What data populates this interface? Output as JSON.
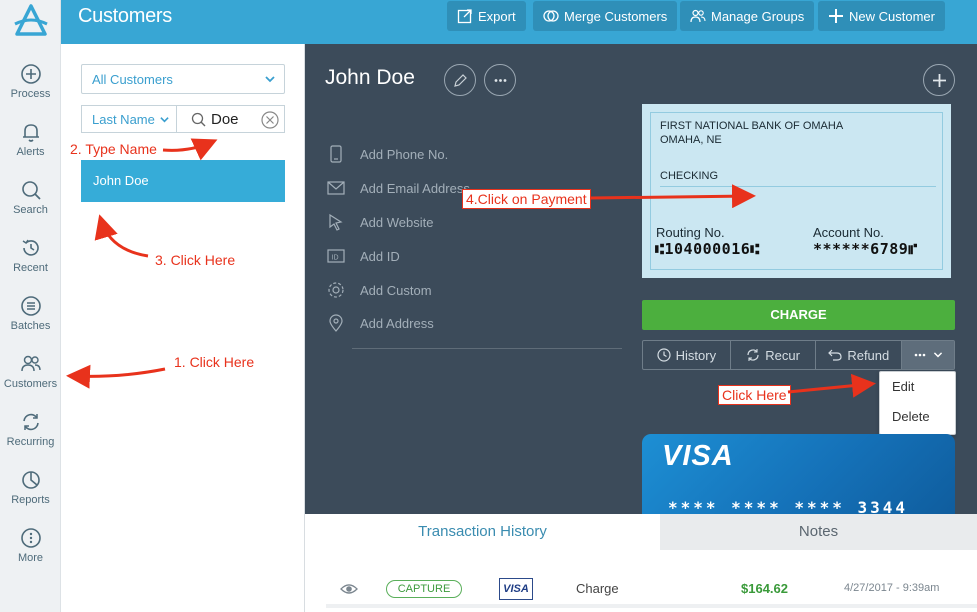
{
  "header": {
    "title": "Customers",
    "buttons": {
      "export": "Export",
      "merge": "Merge Customers",
      "groups": "Manage Groups",
      "new_customer": "New Customer"
    }
  },
  "sidebar": {
    "items": [
      {
        "label": "Process",
        "icon": "plus-circle-icon"
      },
      {
        "label": "Alerts",
        "icon": "bell-icon"
      },
      {
        "label": "Search",
        "icon": "search-icon"
      },
      {
        "label": "Recent",
        "icon": "history-icon"
      },
      {
        "label": "Batches",
        "icon": "list-icon"
      },
      {
        "label": "Customers",
        "icon": "users-icon"
      },
      {
        "label": "Recurring",
        "icon": "recurring-icon"
      },
      {
        "label": "Reports",
        "icon": "reports-icon"
      },
      {
        "label": "More",
        "icon": "more-icon"
      }
    ]
  },
  "search": {
    "filter_value": "All Customers",
    "field_value": "Last Name",
    "query": "Doe",
    "results": [
      "John Doe"
    ]
  },
  "customer": {
    "name": "John Doe",
    "fields": {
      "phone": "Add Phone No.",
      "email": "Add Email Address",
      "website": "Add Website",
      "id": "Add ID",
      "custom": "Add Custom",
      "address": "Add Address"
    }
  },
  "check": {
    "bank_line1": "FIRST NATIONAL BANK OF OMAHA",
    "bank_line2": "OMAHA, NE",
    "account_type": "CHECKING",
    "routing_label": "Routing No.",
    "account_label": "Account No.",
    "routing_number": "⑆104000016⑆",
    "account_number": "******6789⑈"
  },
  "actions": {
    "charge": "CHARGE",
    "history": "History",
    "recur": "Recur",
    "refund": "Refund",
    "menu": [
      "Edit",
      "Delete"
    ]
  },
  "card": {
    "brand": "VISA",
    "number": "**** **** **** 3344"
  },
  "tabs": {
    "history": "Transaction History",
    "notes": "Notes"
  },
  "transaction": {
    "status": "CAPTURE",
    "card_brand": "VISA",
    "type": "Charge",
    "amount": "$164.62",
    "date": "4/27/2017 - 9:39am"
  },
  "annotations": {
    "step1": "1. Click Here",
    "step2": "2. Type Name",
    "step3": "3. Click Here",
    "step4": "4.Click on Payment",
    "step5": "Click Here",
    "color": "#e8321c"
  },
  "colors": {
    "brand_blue": "#38a6d4",
    "dark_panel": "#3c4b5a",
    "charge_green": "#4caf3e"
  }
}
